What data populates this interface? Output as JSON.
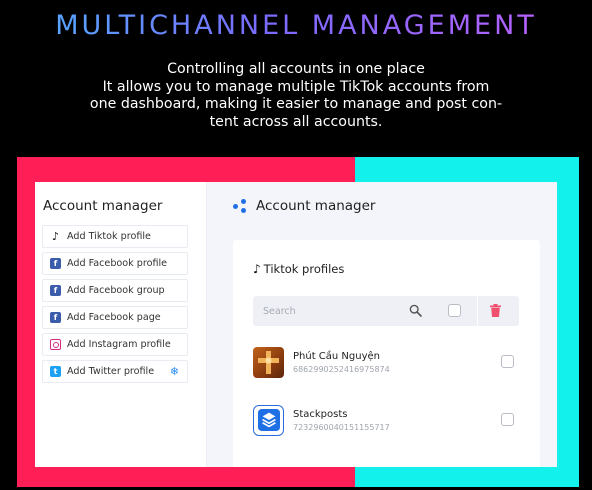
{
  "headline": "MULTICHANNEL MANAGEMENT",
  "description": [
    "Controlling all accounts in one place",
    "It allows you to manage multiple TikTok accounts from",
    "one dashboard, making it easier to manage and post con-",
    "tent across all accounts."
  ],
  "colors": {
    "frame_left": "#ff1e56",
    "frame_right": "#12f1ec",
    "accent": "#1f6fe5"
  },
  "sidebar": {
    "title": "Account manager",
    "items": [
      {
        "label": "Add Tiktok profile",
        "icon": "tiktok-icon"
      },
      {
        "label": "Add Facebook profile",
        "icon": "facebook-icon"
      },
      {
        "label": "Add Facebook group",
        "icon": "facebook-icon"
      },
      {
        "label": "Add Facebook page",
        "icon": "facebook-icon"
      },
      {
        "label": "Add Instagram profile",
        "icon": "instagram-icon"
      },
      {
        "label": "Add Twitter profile",
        "icon": "twitter-icon"
      }
    ]
  },
  "main": {
    "title": "Account manager",
    "panel_title": "Tiktok profiles",
    "search_placeholder": "Search",
    "accounts": [
      {
        "name": "Phút Cầu Nguyện",
        "id": "6862990252416975874"
      },
      {
        "name": "Stackposts",
        "id": "7232960040151155717"
      }
    ]
  }
}
